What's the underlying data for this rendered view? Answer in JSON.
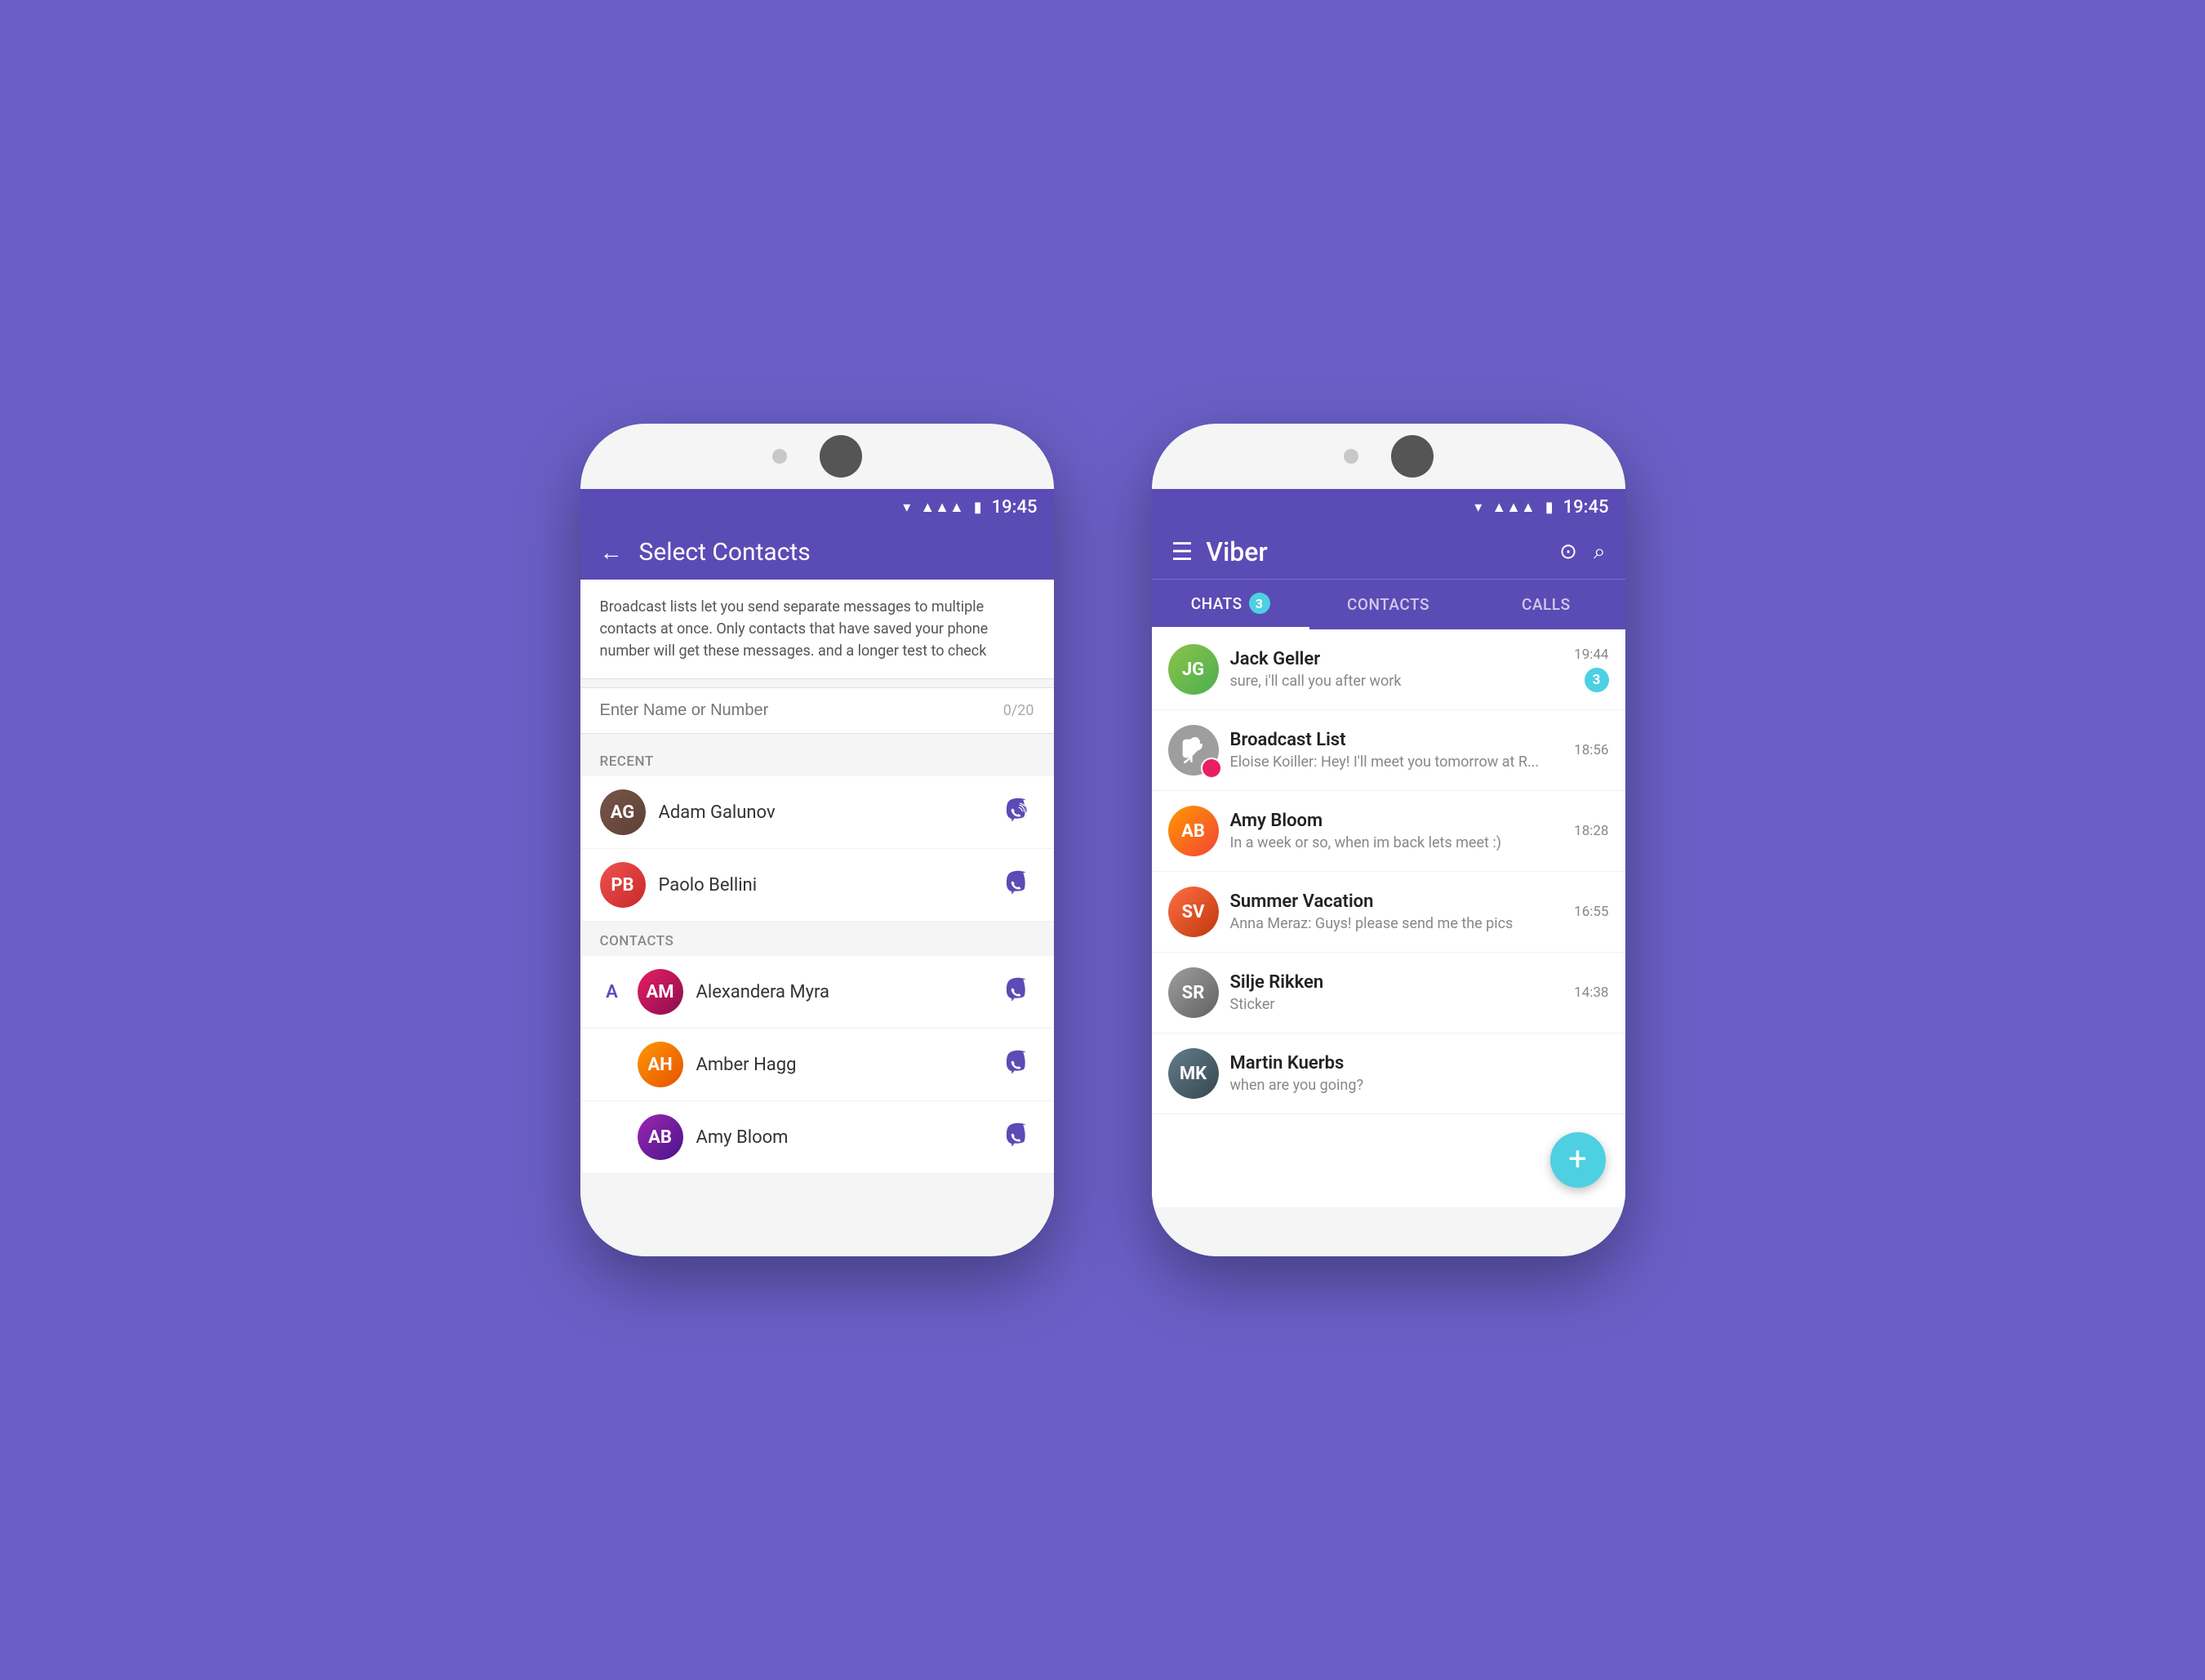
{
  "background": "#6b5fc7",
  "accent": "#5b4bb5",
  "teal": "#4dd0e1",
  "phone1": {
    "status_bar": {
      "time": "19:45"
    },
    "app_bar": {
      "title": "Select Contacts",
      "back_label": "←"
    },
    "broadcast_info": "Broadcast lists let you send separate messages to multiple contacts at once. Only contacts that have saved your phone number will get these messages. and a longer test to check",
    "search": {
      "placeholder": "Enter Name or Number",
      "counter": "0/20"
    },
    "recent_label": "RECENT",
    "recent_contacts": [
      {
        "name": "Adam Galunov",
        "avatar_class": "av-adam",
        "initials": "AG"
      },
      {
        "name": "Paolo Bellini",
        "avatar_class": "av-paolo",
        "initials": "PB"
      }
    ],
    "contacts_label": "CONTACTS",
    "contacts": [
      {
        "alpha": "A",
        "name": "Alexandera Myra",
        "avatar_class": "av-alexmyra",
        "initials": "AM"
      },
      {
        "alpha": "",
        "name": "Amber Hagg",
        "avatar_class": "av-amberh",
        "initials": "AH"
      },
      {
        "alpha": "",
        "name": "Amy Bloom",
        "avatar_class": "av-amybl",
        "initials": "AB"
      }
    ]
  },
  "phone2": {
    "status_bar": {
      "time": "19:45"
    },
    "app_bar": {
      "title": "Viber",
      "menu_icon": "☰",
      "qr_icon": "⊙",
      "search_icon": "⌕"
    },
    "tabs": [
      {
        "label": "CHATS",
        "active": true,
        "badge": "3"
      },
      {
        "label": "CONTACTS",
        "active": false,
        "badge": ""
      },
      {
        "label": "CALLS",
        "active": false,
        "badge": ""
      }
    ],
    "chats": [
      {
        "name": "Jack Geller",
        "preview": "sure, i'll call you after work",
        "time": "19:44",
        "unread": "3",
        "avatar_class": "av-jack",
        "initials": "JG"
      },
      {
        "name": "Broadcast List",
        "preview": "Eloise Koiller: Hey! I'll meet you tomorrow at R...",
        "time": "18:56",
        "unread": "",
        "avatar_class": "av-broadcast",
        "initials": "📢",
        "is_broadcast": true
      },
      {
        "name": "Amy Bloom",
        "preview": "In a week or so, when im back lets meet :)",
        "time": "18:28",
        "unread": "",
        "avatar_class": "av-amy",
        "initials": "AB"
      },
      {
        "name": "Summer Vacation",
        "preview": "Anna Meraz: Guys! please send me the pics",
        "time": "16:55",
        "unread": "",
        "avatar_class": "av-summer",
        "initials": "SV"
      },
      {
        "name": "Silje Rikken",
        "preview": "Sticker",
        "time": "14:38",
        "unread": "",
        "avatar_class": "av-silje",
        "initials": "SR"
      },
      {
        "name": "Martin Kuerbs",
        "preview": "when are you going?",
        "time": "",
        "unread": "",
        "avatar_class": "av-martin",
        "initials": "MK"
      }
    ],
    "fab_label": "+"
  }
}
